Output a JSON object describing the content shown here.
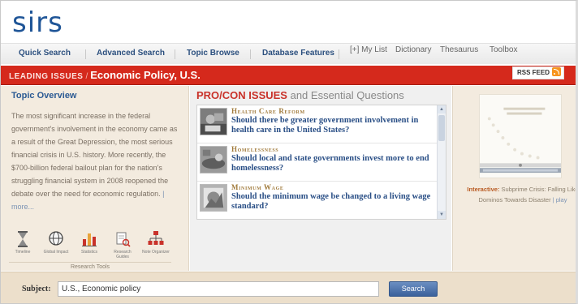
{
  "header": {
    "logo_text": "sirs"
  },
  "nav": {
    "tabs": [
      "Quick Search",
      "Advanced Search",
      "Topic Browse",
      "Database Features"
    ],
    "links": [
      "[+] My List",
      "Dictionary",
      "Thesaurus",
      "Toolbox"
    ]
  },
  "banner": {
    "section": "Leading Issues",
    "separator": "/",
    "topic": "Economic Policy, U.S.",
    "rss_label": "RSS FEED"
  },
  "overview": {
    "title": "Topic Overview",
    "text": "The most significant increase in the federal government's involvement in the economy came as a result of the Great Depression, the most serious financial crisis in U.S. history. More recently, the $700-billion federal bailout plan for the nation's struggling financial system in 2008 reopened the debate over the need for economic regulation.",
    "more": "more..."
  },
  "research_tools": {
    "caption": "Research Tools",
    "items": [
      {
        "label": "Timeline",
        "icon": "hourglass-icon"
      },
      {
        "label": "Global Impact",
        "icon": "globe-icon"
      },
      {
        "label": "Statistics",
        "icon": "bar-chart-icon"
      },
      {
        "label": "Research Guides",
        "icon": "research-guide-icon"
      },
      {
        "label": "Note Organizer",
        "icon": "org-chart-icon"
      }
    ]
  },
  "procon": {
    "title_bold": "PRO/CON ISSUES",
    "title_rest": "and Essential Questions",
    "issues": [
      {
        "category": "Health Care Reform",
        "question": "Should there be greater government involvement in health care in the United States?"
      },
      {
        "category": "Homelessness",
        "question": "Should local and state governments invest more to end homelessness?"
      },
      {
        "category": "Minimum Wage",
        "question": "Should the minimum wage be changed to a living wage standard?"
      }
    ]
  },
  "interactive": {
    "label": "Interactive:",
    "text": "Subprime Crisis: Falling Like Dominos Towards Disaster",
    "play": "play"
  },
  "search": {
    "label": "Subject:",
    "value": "U.S., Economic policy",
    "button": "Search"
  },
  "colors": {
    "banner_red": "#d5291c",
    "link_blue": "#2a4f86",
    "panel_beige": "#f3ebdf"
  }
}
